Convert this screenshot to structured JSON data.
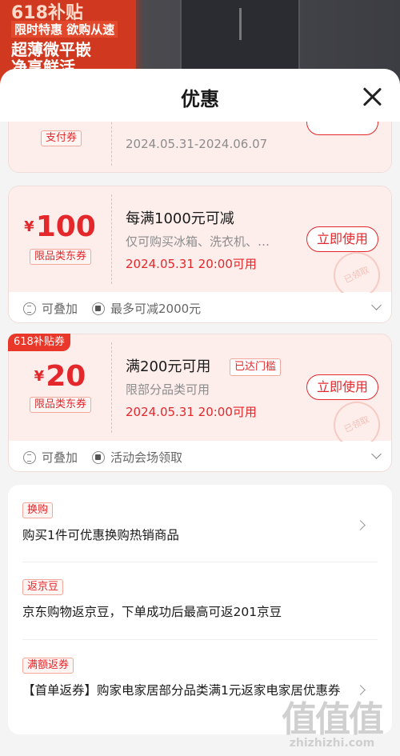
{
  "background": {
    "lines": [
      "618补贴",
      "限时特惠 欲购从速",
      "超薄微平嵌",
      "净享鲜活"
    ]
  },
  "sheet": {
    "title": "优惠"
  },
  "coupons": [
    {
      "tag": "支付券",
      "date": "2024.05.31-2024.06.07"
    },
    {
      "currency": "¥",
      "amount": "100",
      "tag": "限品类东券",
      "title": "每满1000元可减",
      "desc": "仅可购买冰箱、洗衣机、…",
      "date": "2024.05.31 20:00可用",
      "button": "立即使用",
      "stamp": "已领取",
      "foot_stack": "可叠加",
      "foot_info": "最多可减2000元"
    },
    {
      "badge": "618补贴券",
      "currency": "¥",
      "amount": "20",
      "tag": "限品类东券",
      "title": "满200元可用",
      "threshold_tag": "已达门槛",
      "desc": "限部分品类可用",
      "date": "2024.05.31 20:00可用",
      "button": "立即使用",
      "stamp": "已领取",
      "foot_stack": "可叠加",
      "foot_info": "活动会场领取"
    }
  ],
  "promos": [
    {
      "tag": "换购",
      "text": "购买1件可优惠换购热销商品"
    },
    {
      "tag": "返京豆",
      "text": "京东购物返京豆，下单成功后最高可返201京豆"
    },
    {
      "tag": "满额返券",
      "text": "【首单返券】购家电家居部分品类满1元返家电家居优惠券"
    }
  ],
  "watermark": {
    "glyphs": "值值值",
    "url": "zhizhizhi.com"
  }
}
